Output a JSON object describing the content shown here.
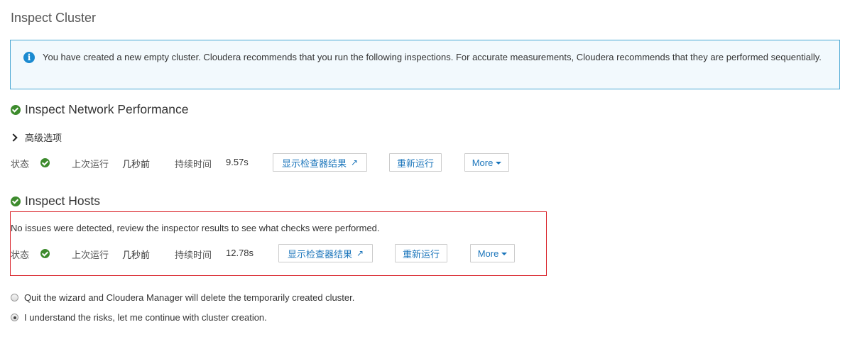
{
  "page": {
    "title": "Inspect Cluster"
  },
  "info": {
    "text": "You have created a new empty cluster. Cloudera recommends that you run the following inspections. For accurate measurements, Cloudera recommends that they are performed sequentially."
  },
  "network": {
    "heading": "Inspect Network Performance",
    "advanced_label": "高级选项",
    "status_label": "状态",
    "last_run_label": "上次运行",
    "last_run_value": "几秒前",
    "duration_label": "持续时间",
    "duration_value": "9.57s",
    "show_results_label": "显示检查器结果",
    "rerun_label": "重新运行",
    "more_label": "More"
  },
  "hosts": {
    "heading": "Inspect Hosts",
    "message": "No issues were detected, review the inspector results to see what checks were performed.",
    "status_label": "状态",
    "last_run_label": "上次运行",
    "last_run_value": "几秒前",
    "duration_label": "持续时间",
    "duration_value": "12.78s",
    "show_results_label": "显示检查器结果",
    "rerun_label": "重新运行",
    "more_label": "More"
  },
  "options": [
    {
      "label": "Quit the wizard and Cloudera Manager will delete the temporarily created cluster.",
      "selected": false
    },
    {
      "label": "I understand the risks, let me continue with cluster creation.",
      "selected": true
    }
  ],
  "colors": {
    "accent": "#1b75bb",
    "success": "#3d8b2d",
    "info_border": "#49a7d3",
    "highlight": "#d9232a"
  }
}
